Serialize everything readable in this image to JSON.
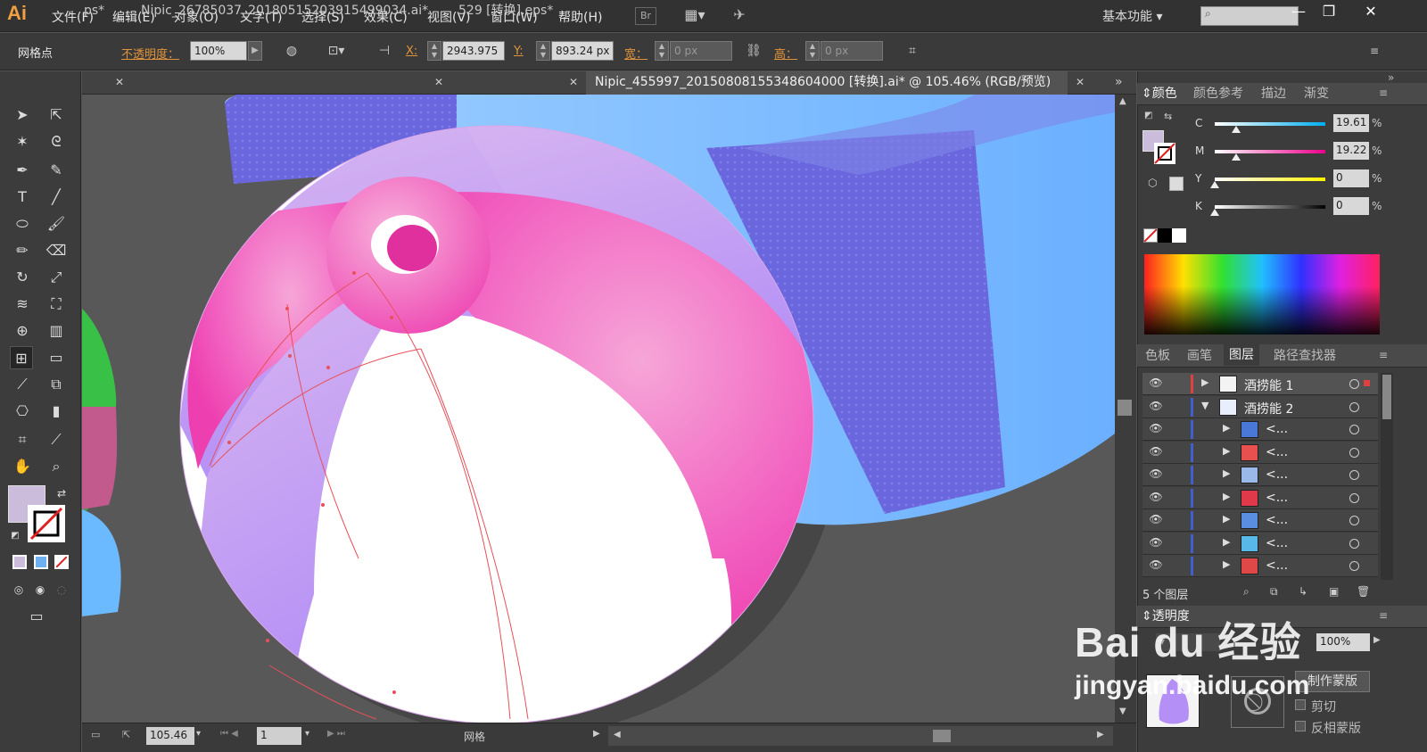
{
  "app": {
    "logo": "Ai"
  },
  "menu": [
    "文件(F)",
    "编辑(E)",
    "对象(O)",
    "文字(T)",
    "选择(S)",
    "效果(C)",
    "视图(V)",
    "窗口(W)",
    "帮助(H)"
  ],
  "menubar_icons": {
    "bridge": "Br",
    "arrange": "layout-grid-icon",
    "sync": "sync-icon"
  },
  "workspace": "基本功能",
  "control": {
    "selection_type": "网格点",
    "opacity_label": "不透明度：",
    "opacity_value": "100%",
    "x_label": "X:",
    "x_value": "2943.975",
    "y_label": "Y:",
    "y_value": "893.24 px",
    "w_label": "宽：",
    "w_value": "0 px",
    "h_label": "高：",
    "h_value": "0 px"
  },
  "tabs": [
    {
      "label": "ps*",
      "active": false
    },
    {
      "label": "Nipic_26785037_20180515203915499034.ai*",
      "active": false
    },
    {
      "label": "529 [转换].eps*",
      "active": false
    },
    {
      "label": "Nipic_455997_20150808155348604000 [转换].ai* @ 105.46% (RGB/预览)",
      "active": true
    }
  ],
  "status": {
    "zoom": "105.46",
    "artboard": "1",
    "tool_name": "网格"
  },
  "color_panel": {
    "tabs": [
      "颜色",
      "颜色参考",
      "描边",
      "渐变"
    ],
    "fill_color": "#cbbcdb",
    "cmyk": [
      {
        "label": "C",
        "value": "19.61",
        "fraction": 0.196,
        "gradient": "linear-gradient(90deg,#fff,#00aeef)"
      },
      {
        "label": "M",
        "value": "19.22",
        "fraction": 0.192,
        "gradient": "linear-gradient(90deg,#fff,#ec008c)"
      },
      {
        "label": "Y",
        "value": "0",
        "fraction": 0,
        "gradient": "linear-gradient(90deg,#fff,#fff200)"
      },
      {
        "label": "K",
        "value": "0",
        "fraction": 0,
        "gradient": "linear-gradient(90deg,#fff,#000)"
      }
    ],
    "percent": "%"
  },
  "layers_panel": {
    "tabs": [
      "色板",
      "画笔",
      "图层",
      "路径查找器"
    ],
    "rows": [
      {
        "name": "酒捞能 1",
        "expanded": false,
        "indent": 0,
        "bar_color": "#e04040",
        "thumb": "#f3f3f3"
      },
      {
        "name": "酒捞能 2",
        "expanded": true,
        "indent": 0,
        "bar_color": "#4060d0",
        "thumb": "#e8eefc"
      },
      {
        "name": "<...",
        "expanded": false,
        "indent": 1,
        "bar_color": "#4060d0",
        "thumb": "#4a78d8"
      },
      {
        "name": "<...",
        "expanded": false,
        "indent": 1,
        "bar_color": "#4060d0",
        "thumb": "#e85050"
      },
      {
        "name": "<...",
        "expanded": false,
        "indent": 1,
        "bar_color": "#4060d0",
        "thumb": "#9ab8e8"
      },
      {
        "name": "<...",
        "expanded": false,
        "indent": 1,
        "bar_color": "#4060d0",
        "thumb": "#e03a4a"
      },
      {
        "name": "<...",
        "expanded": false,
        "indent": 1,
        "bar_color": "#4060d0",
        "thumb": "#5a8ee0"
      },
      {
        "name": "<...",
        "expanded": false,
        "indent": 1,
        "bar_color": "#4060d0",
        "thumb": "#58b8e8"
      },
      {
        "name": "<...",
        "expanded": false,
        "indent": 1,
        "bar_color": "#4060d0",
        "thumb": "#e04848"
      }
    ],
    "count": "5 个图层"
  },
  "transparency_panel": {
    "title": "透明度",
    "opacity_value": "100%",
    "make_mask": "制作蒙版",
    "clip": "剪切",
    "invert_mask": "反相蒙版"
  },
  "watermark": {
    "brand": "Bai du 经验",
    "url": "jingyan.baidu.com"
  }
}
